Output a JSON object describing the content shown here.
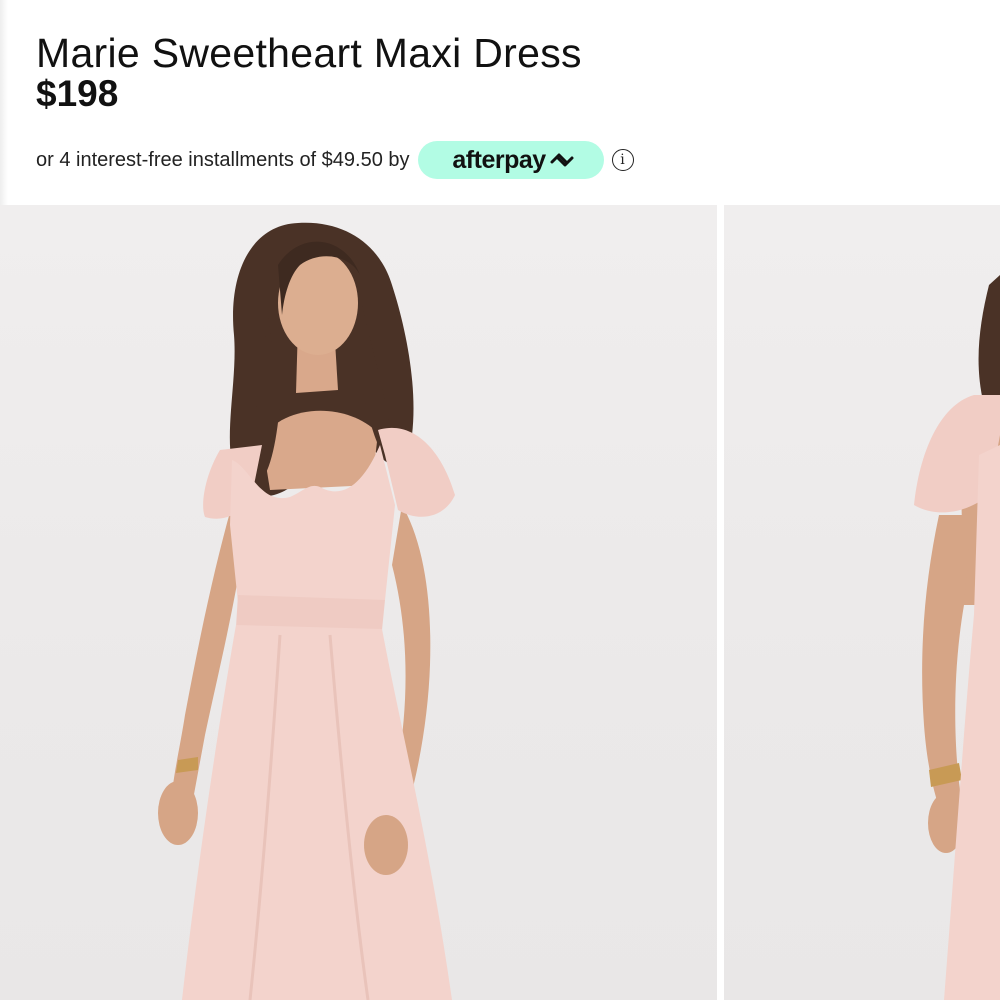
{
  "product": {
    "title": "Marie Sweetheart Maxi Dress",
    "price": "$198"
  },
  "payment": {
    "installments_text": "or 4 interest-free installments of $49.50 by",
    "provider_name": "afterpay",
    "provider_icon": "afterpay-arrows-icon",
    "info_icon": "info-circle-icon",
    "info_glyph": "i",
    "badge_color": "#b2fce4"
  },
  "gallery": {
    "images": [
      {
        "name": "model-front-view",
        "alt": ""
      },
      {
        "name": "model-side-view",
        "alt": ""
      }
    ]
  },
  "colors": {
    "dress": "#f3d3cc",
    "background": "#ebe9e9"
  }
}
